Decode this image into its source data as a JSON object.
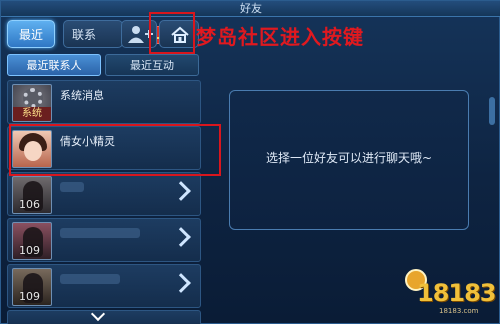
{
  "window": {
    "title": "好友"
  },
  "tabs": {
    "recent": "最近",
    "contacts": "联系",
    "add_icon": "add-friend-icon",
    "home_icon": "home-icon",
    "redbag_icon": "red-envelope-icon"
  },
  "annotation": {
    "label": "梦岛社区进入按键",
    "color": "#d9161d"
  },
  "subtabs": {
    "recent_contacts": "最近联系人",
    "recent_interactions": "最近互动"
  },
  "list": {
    "items": [
      {
        "name": "系统消息",
        "badge": "系统",
        "avatar": "system-gear-icon"
      },
      {
        "name": "倩女小精灵",
        "avatar": "fairy-avatar"
      },
      {
        "level": "106",
        "avatar": "player-avatar"
      },
      {
        "level": "109",
        "avatar": "player-avatar"
      },
      {
        "level": "109",
        "avatar": "player-avatar"
      }
    ]
  },
  "chat": {
    "hint": "选择一位好友可以进行聊天哦~"
  },
  "watermark": {
    "brand": "18183",
    "sub": "18183.com"
  },
  "colors": {
    "accent": "#4fb0ff",
    "annotation": "#d9161d",
    "watermark": "#f0c03a"
  }
}
